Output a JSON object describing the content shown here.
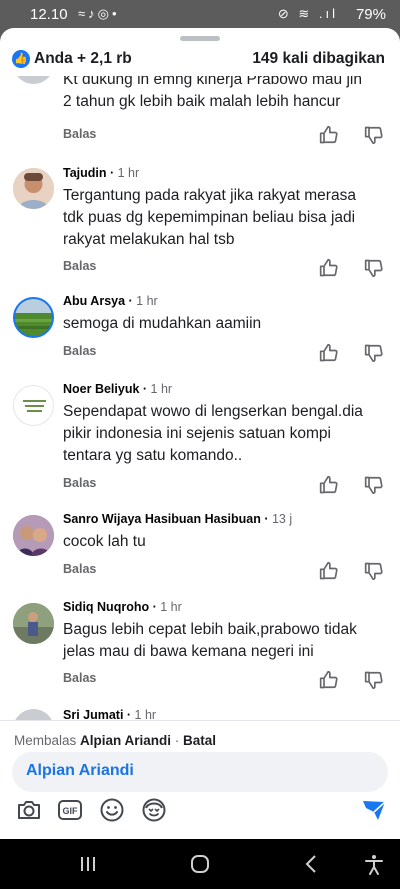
{
  "status_bar": {
    "time": "12.10",
    "left_icons": "≈♪◎•",
    "right_icons": "⊘ ≋ .ıl",
    "battery": "79%"
  },
  "header": {
    "reactions": "Anda + 2,1 rb",
    "shares": "149 kali dibagikan"
  },
  "comments": [
    {
      "name": "",
      "time": "",
      "text": "Kt dukung lh emng kinerja Prabowo mau jln 2 tahun gk lebih baik malah lebih hancur",
      "reply": "Balas"
    },
    {
      "name": "Tajudin",
      "time": "1 hr",
      "text": "Tergantung pada rakyat jika rakyat merasa tdk puas dg kepemimpinan beliau bisa jadi rakyat melakukan hal tsb",
      "reply": "Balas"
    },
    {
      "name": "Abu Arsya",
      "time": "1 hr",
      "text": "semoga di mudahkan aamiin",
      "reply": "Balas"
    },
    {
      "name": "Noer Beliyuk",
      "time": "1 hr",
      "text": "Sependapat wowo di lengserkan bengal.dia pikir indonesia ini sejenis satuan kompi tentara yg satu komando..",
      "reply": "Balas"
    },
    {
      "name": "Sanro Wijaya Hasibuan Hasibuan",
      "time": "13 j",
      "text": "cocok lah tu",
      "reply": "Balas"
    },
    {
      "name": "Sidiq Nuqroho",
      "time": "1 hr",
      "text": "Bagus lebih cepat lebih baik,prabowo tidak jelas mau di bawa kemana negeri ini",
      "reply": "Balas"
    },
    {
      "name": "Sri Jumati",
      "time": "1 hr",
      "text": "",
      "reply": ""
    }
  ],
  "reply_bar": {
    "replying_prefix": "Membalas ",
    "replying_name": "Alpian Ariandi",
    "separator": " · ",
    "cancel": "Batal",
    "mention": "Alpian Ariandi"
  },
  "colors": {
    "accent": "#1877f2",
    "mention": "#1b74e4",
    "secondary_text": "#65676b"
  }
}
